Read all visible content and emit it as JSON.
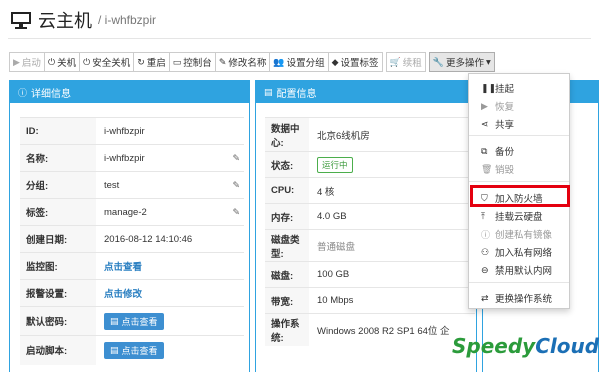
{
  "header": {
    "title": "云主机",
    "subtitle": "/ i-whfbzpir"
  },
  "toolbar": [
    {
      "label": "启动",
      "icon": "play-icon",
      "glyph": "▶",
      "disabled": true
    },
    {
      "label": "关机",
      "icon": "power-icon",
      "glyph": "⏻",
      "disabled": false
    },
    {
      "label": "安全关机",
      "icon": "power-icon",
      "glyph": "⏻",
      "disabled": false
    },
    {
      "label": "重启",
      "icon": "refresh-icon",
      "glyph": "↻",
      "disabled": false
    },
    {
      "label": "控制台",
      "icon": "desktop-icon",
      "glyph": "▭",
      "disabled": false
    },
    {
      "label": "修改名称",
      "icon": "edit-icon",
      "glyph": "✎",
      "disabled": false
    },
    {
      "label": "设置分组",
      "icon": "users-icon",
      "glyph": "👥",
      "disabled": false
    },
    {
      "label": "设置标签",
      "icon": "tags-icon",
      "glyph": "◆",
      "disabled": false
    },
    {
      "label": "续租",
      "icon": "cart-icon",
      "glyph": "🛒",
      "disabled": true
    },
    {
      "label": "更多操作",
      "icon": "wrench-icon",
      "glyph": "🔧",
      "disabled": false,
      "caret": "▾"
    }
  ],
  "detail_panel": {
    "title": "详细信息",
    "rows": [
      {
        "key": "ID:",
        "value": "i-whfbzpir",
        "editable": false,
        "type": "text"
      },
      {
        "key": "名称:",
        "value": "i-whfbzpir",
        "editable": true,
        "type": "text"
      },
      {
        "key": "分组:",
        "value": "test",
        "editable": true,
        "type": "text"
      },
      {
        "key": "标签:",
        "value": "manage-2",
        "editable": true,
        "type": "text"
      },
      {
        "key": "创建日期:",
        "value": "2016-08-12 14:10:46",
        "editable": false,
        "type": "text"
      },
      {
        "key": "监控图:",
        "value": "点击查看",
        "editable": false,
        "type": "link"
      },
      {
        "key": "报警设置:",
        "value": "点击修改",
        "editable": false,
        "type": "link"
      },
      {
        "key": "默认密码:",
        "value": "点击查看",
        "editable": false,
        "type": "button"
      },
      {
        "key": "启动脚本:",
        "value": "点击查看",
        "editable": false,
        "type": "button"
      }
    ]
  },
  "config_panel": {
    "title": "配置信息",
    "rows": [
      {
        "key": "数据中心:",
        "value": "北京6线机房",
        "type": "text"
      },
      {
        "key": "状态:",
        "value": "运行中",
        "type": "badge"
      },
      {
        "key": "CPU:",
        "value": "4 核",
        "type": "text"
      },
      {
        "key": "内存:",
        "value": "4.0 GB",
        "type": "text"
      },
      {
        "key": "磁盘类型:",
        "value": "普通磁盘",
        "type": "gray"
      },
      {
        "key": "磁盘:",
        "value": "100 GB",
        "type": "text"
      },
      {
        "key": "带宽:",
        "value": "10 Mbps",
        "type": "text"
      },
      {
        "key": "操作系统:",
        "value": "Windows 2008 R2 SP1 64位 企",
        "type": "text"
      }
    ]
  },
  "dropdown": {
    "items": [
      {
        "label": "挂起",
        "icon": "pause-icon",
        "glyph": "❚❚",
        "disabled": false
      },
      {
        "label": "恢复",
        "icon": "play-circle-icon",
        "glyph": "▶",
        "disabled": true
      },
      {
        "label": "共享",
        "icon": "share-icon",
        "glyph": "⋖",
        "disabled": false
      },
      {
        "label": "备份",
        "icon": "copy-icon",
        "glyph": "⧉",
        "disabled": false
      },
      {
        "label": "销毁",
        "icon": "trash-icon",
        "glyph": "🗑",
        "disabled": true
      },
      {
        "label": "加入防火墙",
        "icon": "shield-icon",
        "glyph": "⛉",
        "disabled": false
      },
      {
        "label": "挂载云硬盘",
        "icon": "upload-icon",
        "glyph": "⤒",
        "disabled": false
      },
      {
        "label": "创建私有镜像",
        "icon": "info-icon",
        "glyph": "ⓘ",
        "disabled": true
      },
      {
        "label": "加入私有网络",
        "icon": "sitemap-icon",
        "glyph": "⚇",
        "disabled": false
      },
      {
        "label": "禁用默认内网",
        "icon": "minus-circle-icon",
        "glyph": "⊖",
        "disabled": false
      },
      {
        "label": "更换操作系统",
        "icon": "exchange-icon",
        "glyph": "⇄",
        "disabled": false
      }
    ]
  },
  "logo": {
    "part1": "Speedy",
    "part2": "Cloud",
    "mark": "®"
  },
  "colors": {
    "accent": "#2fa3e0",
    "highlight": "#e4000f",
    "link": "#2a7fc1",
    "button": "#3d8fd1",
    "success": "#4cae4c"
  }
}
